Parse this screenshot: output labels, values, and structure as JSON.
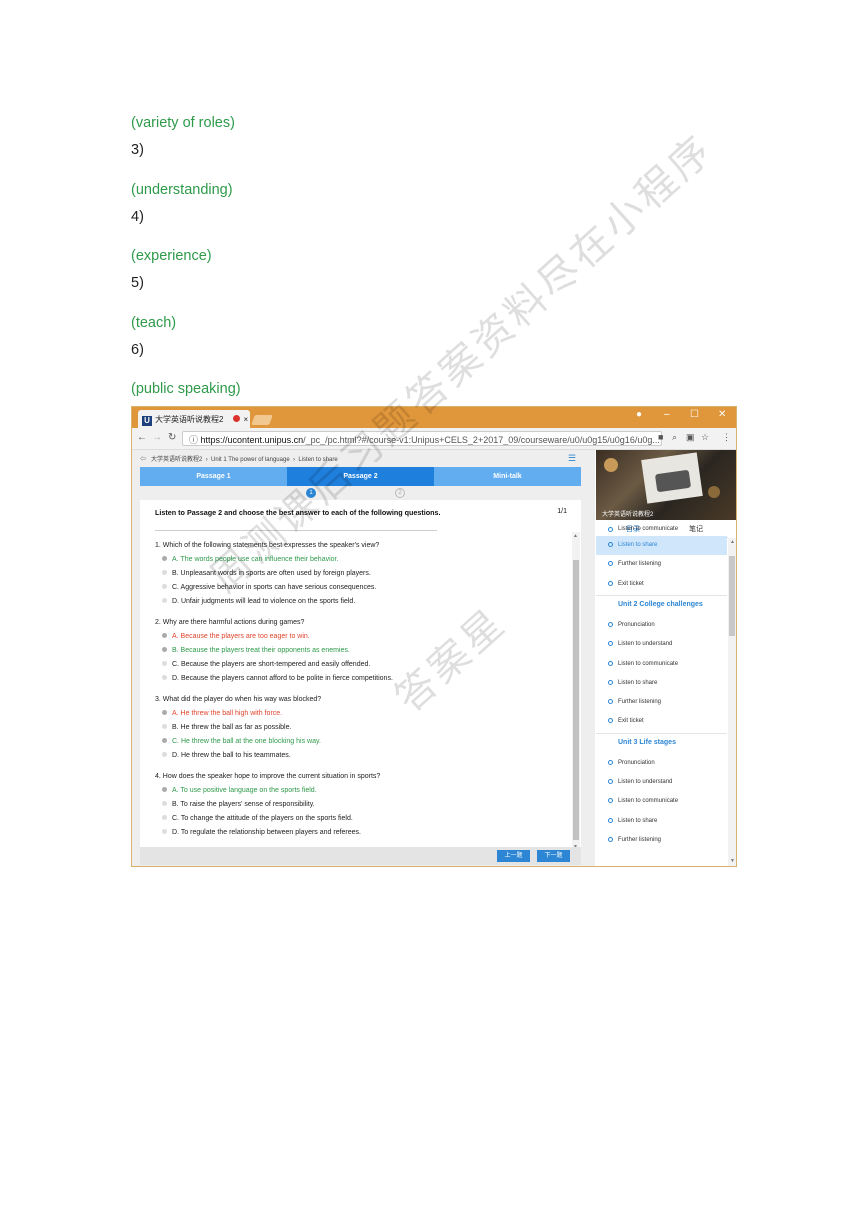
{
  "doc_lines": [
    {
      "text": "(variety of roles)",
      "color": "#2e9a4a"
    },
    {
      "text": "3)",
      "color": "#222222"
    },
    {
      "text": "(understanding)",
      "color": "#2e9a4a"
    },
    {
      "text": "4)",
      "color": "#222222"
    },
    {
      "text": "(experience)",
      "color": "#2e9a4a"
    },
    {
      "text": "5)",
      "color": "#222222"
    },
    {
      "text": "(teach)",
      "color": "#2e9a4a"
    },
    {
      "text": "6)",
      "color": "#222222"
    },
    {
      "text": "(public speaking)",
      "color": "#2e9a4a"
    }
  ],
  "browser": {
    "tab_logo": "U",
    "tab_title": "大学英语听说教程2",
    "tab_close": "×",
    "url_host": "https://ucontent.unipus.cn",
    "url_path": "/_pc_/pc.html?#/course-v1:Unipus+CELS_2+2017_09/courseware/u0/u0g15/u0g16/u0g...",
    "icons": [
      "back-icon",
      "forward-icon",
      "reload-icon",
      "info-icon",
      "camera-icon",
      "zoom-icon",
      "translate-icon",
      "star-icon",
      "menu-icon"
    ]
  },
  "breadcrumb": {
    "course": "大学英语听说教程2",
    "unit": "Unit 1 The power of language",
    "section": "Listen to share"
  },
  "passage_tabs": [
    {
      "label": "Passage 1",
      "active": false
    },
    {
      "label": "Passage 2",
      "active": true
    },
    {
      "label": "Mini-talk",
      "active": false
    }
  ],
  "steps": [
    "1",
    "2"
  ],
  "instruction": "Listen to Passage 2 and choose the best answer to each of the following questions.",
  "pager": "1/1",
  "questions": [
    {
      "text": "1. Which of the following statements best expresses the speaker's view?",
      "options": [
        {
          "text": "A. The words people use can influence their behavior.",
          "state": "correct"
        },
        {
          "text": "B. Unpleasant words in sports are often used by foreign players.",
          "state": "none"
        },
        {
          "text": "C. Aggressive behavior in sports can have serious consequences.",
          "state": "none"
        },
        {
          "text": "D. Unfair judgments will lead to violence on the sports field.",
          "state": "none"
        }
      ]
    },
    {
      "text": "2. Why are there harmful actions during games?",
      "options": [
        {
          "text": "A. Because the players are too eager to win.",
          "state": "wrong"
        },
        {
          "text": "B. Because the players treat their opponents as enemies.",
          "state": "correct"
        },
        {
          "text": "C. Because the players are short-tempered and easily offended.",
          "state": "none"
        },
        {
          "text": "D. Because the players cannot afford to be polite in fierce competitions.",
          "state": "none"
        }
      ]
    },
    {
      "text": "3. What did the player do when his way was blocked?",
      "options": [
        {
          "text": "A. He threw the ball high with force.",
          "state": "wrong"
        },
        {
          "text": "B. He threw the ball as far as possible.",
          "state": "none"
        },
        {
          "text": "C. He threw the ball at the one blocking his way.",
          "state": "correct"
        },
        {
          "text": "D. He threw the ball to his teammates.",
          "state": "none"
        }
      ]
    },
    {
      "text": "4. How does the speaker hope to improve the current situation in sports?",
      "options": [
        {
          "text": "A. To use positive language on the sports field.",
          "state": "correct"
        },
        {
          "text": "B. To raise the players' sense of responsibility.",
          "state": "none"
        },
        {
          "text": "C. To change the attitude of the players on the sports field.",
          "state": "none"
        },
        {
          "text": "D. To regulate the relationship between players and referees.",
          "state": "none"
        }
      ]
    }
  ],
  "footer": {
    "prev": "上一题",
    "next": "下一题"
  },
  "sidebar": {
    "banner_title": "大学英语听说教程2",
    "tabs": [
      "目录",
      "笔记"
    ],
    "items": [
      {
        "type": "item",
        "label": "Listen to communicate",
        "active": false
      },
      {
        "type": "item",
        "label": "Listen to share",
        "active": true
      },
      {
        "type": "item",
        "label": "Further listening",
        "active": false
      },
      {
        "type": "item",
        "label": "Exit ticket",
        "active": false
      },
      {
        "type": "unit",
        "label": "Unit 2 College challenges"
      },
      {
        "type": "item",
        "label": "Pronunciation",
        "active": false
      },
      {
        "type": "item",
        "label": "Listen to understand",
        "active": false
      },
      {
        "type": "item",
        "label": "Listen to communicate",
        "active": false
      },
      {
        "type": "item",
        "label": "Listen to share",
        "active": false
      },
      {
        "type": "item",
        "label": "Further listening",
        "active": false
      },
      {
        "type": "item",
        "label": "Exit ticket",
        "active": false
      },
      {
        "type": "unit",
        "label": "Unit 3 Life stages"
      },
      {
        "type": "item",
        "label": "Pronunciation",
        "active": false
      },
      {
        "type": "item",
        "label": "Listen to understand",
        "active": false
      },
      {
        "type": "item",
        "label": "Listen to communicate",
        "active": false
      },
      {
        "type": "item",
        "label": "Listen to share",
        "active": false
      },
      {
        "type": "item",
        "label": "Further listening",
        "active": false
      }
    ]
  },
  "watermark": [
    "周测课后习题答案资料尽在小程序",
    "答案星"
  ],
  "colors": {
    "green": "#2e9a4a",
    "red": "#e0452e",
    "accent": "#2c86d4",
    "titlebar": "#e0963a"
  }
}
